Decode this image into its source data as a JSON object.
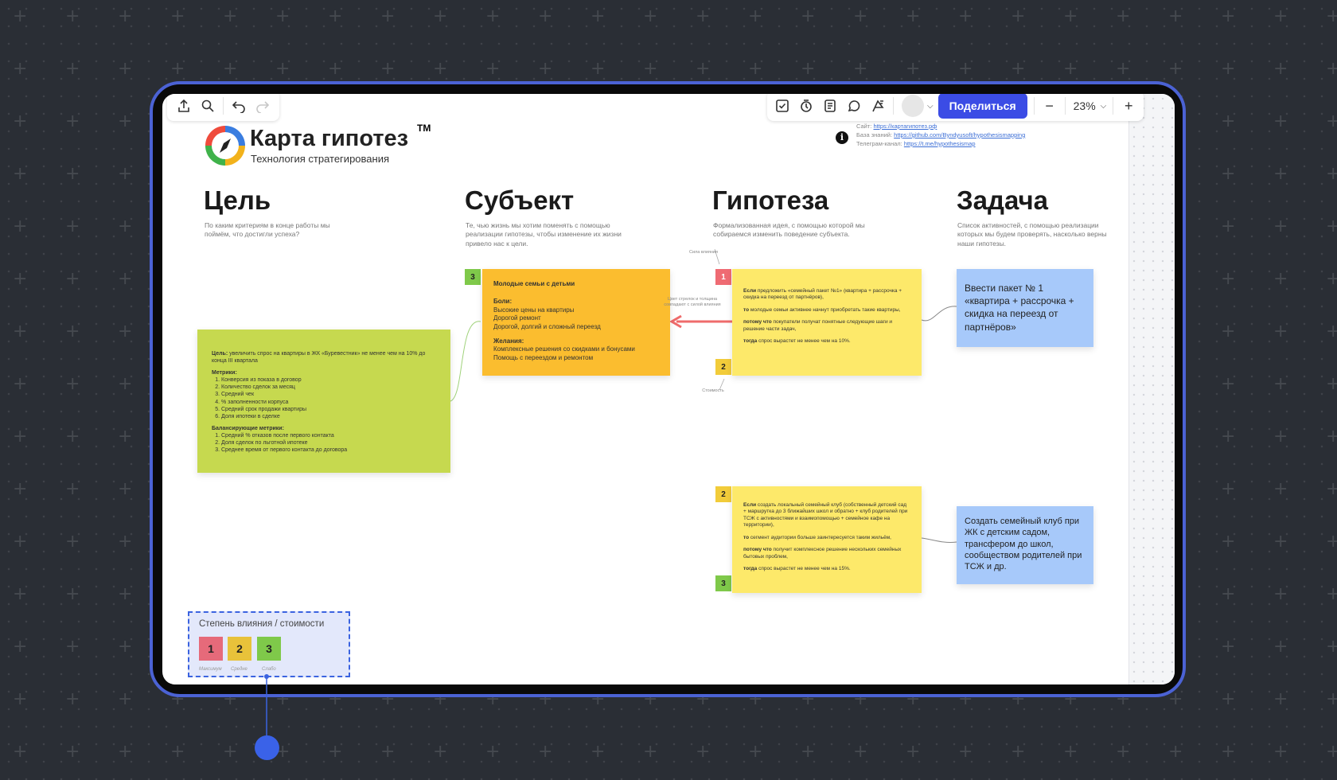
{
  "toolbar_left": {
    "icons": [
      "export-icon",
      "search-icon",
      "undo-icon",
      "redo-icon"
    ]
  },
  "toolbar_right": {
    "icons": [
      "checkbox-icon",
      "timer-icon",
      "notes-icon",
      "comment-icon",
      "flag-icon"
    ],
    "share_label": "Поделиться",
    "zoom": "23%"
  },
  "logo": {
    "title": "Карта гипотез",
    "tm": "TM",
    "subtitle": "Технология стратегирования"
  },
  "info": {
    "site_label": "Сайт:",
    "site_link": "https://картагипотез.рф",
    "kb_label": "База знаний:",
    "kb_link": "https://github.com/Byndyusoft/hypothesismapping",
    "tg_label": "Телеграм-канал:",
    "tg_link": "https://t.me/hypothesismap"
  },
  "columns": [
    {
      "title": "Цель",
      "desc": "По каким критериям в конце работы мы поймём, что достигли успеха?"
    },
    {
      "title": "Субъект",
      "desc": "Те, чью жизнь мы хотим поменять с помощью реализации гипотезы, чтобы изменение их жизни привело нас к цели."
    },
    {
      "title": "Гипотеза",
      "desc": "Формализованная идея, с помощью которой мы собираемся изменить поведение субъекта."
    },
    {
      "title": "Задача",
      "desc": "Список активностей, с помощью реализации которых мы будем проверять, насколько верны наши гипотезы."
    }
  ],
  "goal_note": {
    "goal_label": "Цель:",
    "goal_text": " увеличить спрос на квартиры в ЖК «Буревестник» не менее чем на 10% до конца III квартала",
    "metrics_label": "Метрики:",
    "metrics": [
      "Конверсия из показа в договор",
      "Количество сделок за месяц",
      "Средний чек",
      "% заполненности корпуса",
      "Средний срок продажи квартиры",
      "Доля ипотеки в сделке"
    ],
    "bal_label": "Балансирующие метрики:",
    "balancing": [
      "Средний % отказов после первого контакта",
      "Доля сделок по льготной ипотеке",
      "Среднее время от первого контакта до договора"
    ]
  },
  "subject_note": {
    "badge": "3",
    "title": "Молодые семьи с детьми",
    "pains_label": "Боли:",
    "pains": [
      "Высокие цены на квартиры",
      "Дорогой ремонт",
      "Дорогой, долгий и сложный переезд"
    ],
    "wants_label": "Желания:",
    "wants": [
      "Комплексные решения со скидками и бонусами",
      "Помощь с переездом и ремонтом"
    ]
  },
  "hyp1": {
    "badge_top": "1",
    "badge_bottom": "2",
    "if_label": "Если",
    "if_text": " предложить «семейный пакет №1» (квартира + рассрочка + скидка на переезд от партнёров),",
    "then_label": "то",
    "then_text": " молодые семьи активнее начнут приобретать такие квартиры,",
    "because_label": "потому что",
    "because_text": " покупатели получат понятные следующие шаги и решение части задач,",
    "when_label": "тогда",
    "when_text": " спрос вырастет не менее чем на 10%."
  },
  "hyp2": {
    "badge_top": "2",
    "badge_bottom": "3",
    "if_label": "Если",
    "if_text": " создать локальный семейный клуб (собственный детский сад + маршрутка до 3 ближайших школ и обратно + клуб родителей при ТСЖ с активностями и взаимопомощью + семейное кафе на территории),",
    "then_label": "то",
    "then_text": " сегмент аудитории больше заинтересуется таким жильём,",
    "because_label": "потому что",
    "because_text": " получит комплексное решение нескольких семейных бытовых проблем,",
    "when_label": "тогда",
    "when_text": " спрос вырастет не менее чем на 15%."
  },
  "task1": {
    "text": "Ввести пакет № 1 «квартира + рассрочка + скидка на переезд от партнёров»"
  },
  "task2": {
    "text": "Создать семейный клуб при ЖК с детским садом, трансфером до школ, сообществом родителей при ТСЖ и др."
  },
  "annotations": {
    "top": "Сила влияния",
    "arrow": "Цвет стрелок и толщина совпадают с силой влияния",
    "bottom": "Стоимость"
  },
  "legend": {
    "title": "Степень влияния / стоимости",
    "items": [
      {
        "num": "1",
        "caption": "Максимум",
        "color": "#e66a7a"
      },
      {
        "num": "2",
        "caption": "Средне",
        "color": "#e8c23a"
      },
      {
        "num": "3",
        "caption": "Слабо",
        "color": "#7fc94a"
      }
    ]
  }
}
